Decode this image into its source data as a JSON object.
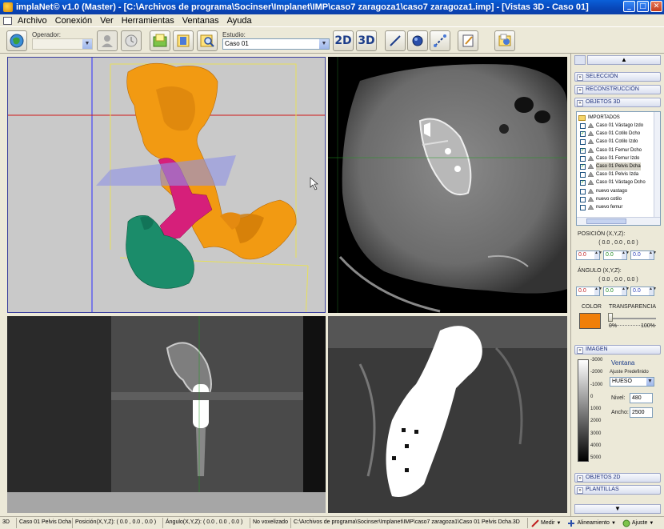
{
  "window": {
    "title": "implaNet© v1.0 (Master) - [C:\\Archivos de programa\\Socinser\\Implanet\\IMP\\caso7 zaragoza1\\caso7 zaragoza1.imp] - [Vistas 3D - Caso 01]",
    "controls": {
      "minimize": "_",
      "maximize": "□",
      "close": "✕"
    }
  },
  "menu": [
    "Archivo",
    "Conexión",
    "Ver",
    "Herramientas",
    "Ventanas",
    "Ayuda"
  ],
  "toolbar": {
    "operador_label": "Operador:",
    "operador_value": "",
    "estudio_label": "Estudio:",
    "estudio_value": "Caso 01",
    "btn_2d": "2D",
    "btn_3d": "3D"
  },
  "right_panel": {
    "sections": {
      "seleccion": "SELECCIÓN",
      "reconstruccion": "RECONSTRUCCIÓN",
      "objetos3d": "OBJETOS 3D",
      "imagen": "IMAGEN",
      "objetos2d": "OBJETOS 2D",
      "plantillas": "PLANTILLAS"
    },
    "tree_root": "IMPORTADOS",
    "tree_items": [
      {
        "label": "Caso 01 Vástago Izdo",
        "checked": false,
        "selected": false
      },
      {
        "label": "Caso 01 Cotilo Dcho",
        "checked": true,
        "selected": false
      },
      {
        "label": "Caso 01 Cotilo Izdo",
        "checked": false,
        "selected": false
      },
      {
        "label": "Caso 01 Femur Dcho",
        "checked": true,
        "selected": false
      },
      {
        "label": "Caso 01 Femur Izdo",
        "checked": false,
        "selected": false
      },
      {
        "label": "Caso 01 Pelvis Dcha",
        "checked": true,
        "selected": true
      },
      {
        "label": "Caso 01 Pelvis Izda",
        "checked": false,
        "selected": false
      },
      {
        "label": "Caso 01 Vástago Dcho",
        "checked": true,
        "selected": false
      },
      {
        "label": "nuevo vastago",
        "checked": false,
        "selected": false
      },
      {
        "label": "nuevo cotilo",
        "checked": false,
        "selected": false
      },
      {
        "label": "nuevo femur",
        "checked": false,
        "selected": false
      }
    ],
    "posicion_label": "POSICIÓN (X,Y,Z):",
    "posicion_value": "( 0.0 , 0.0 , 0.0 )",
    "posicion_inputs": [
      "0.0",
      "0.0",
      "0.0"
    ],
    "angulo_label": "ÁNGULO (X,Y,Z):",
    "angulo_value": "( 0.0 , 0.0 , 0.0 )",
    "angulo_inputs": [
      "0.0",
      "0.0",
      "0.0"
    ],
    "color_label": "COLOR",
    "color_value": "#f07f0a",
    "transparencia_label": "TRANSPARENCIA",
    "transparencia_min": "0%",
    "transparencia_max": "100%",
    "transparencia_value": 0,
    "imagen": {
      "ventana_label": "Ventana",
      "ajuste_label": "Ajuste Predefinido",
      "ajuste_value": "HUESO",
      "nivel_label": "Nivel:",
      "nivel_value": "480",
      "ancho_label": "Ancho:",
      "ancho_value": "2500",
      "scale": [
        "-3000",
        "-2000",
        "-1000",
        "0",
        "1000",
        "2000",
        "3000",
        "4000",
        "5000"
      ]
    }
  },
  "statusbar": {
    "mode": "3D",
    "object": "Caso 01 Pelvis Dcha",
    "posicion": "Posición(X,Y,Z): ( 0.0 , 0.0 , 0.0 )",
    "angulo": "Ángulo(X,Y,Z): ( 0.0 , 0.0 , 0.0 )",
    "voxel": "No voxelizado",
    "path": "C:\\Archivos de programa\\Socinser\\Implanet\\IMP\\caso7 zaragoza1\\Caso 01 Pelvis Dcha.3D",
    "medir": "Medir",
    "alineamiento": "Alineamiento",
    "ajuste": "Ajuste"
  },
  "colors": {
    "pelvis": "#f29a12",
    "femur": "#1b8c6a",
    "stem": "#d61f7a",
    "plane": "#8f93e6",
    "selection_border": "#3a3f9e"
  }
}
